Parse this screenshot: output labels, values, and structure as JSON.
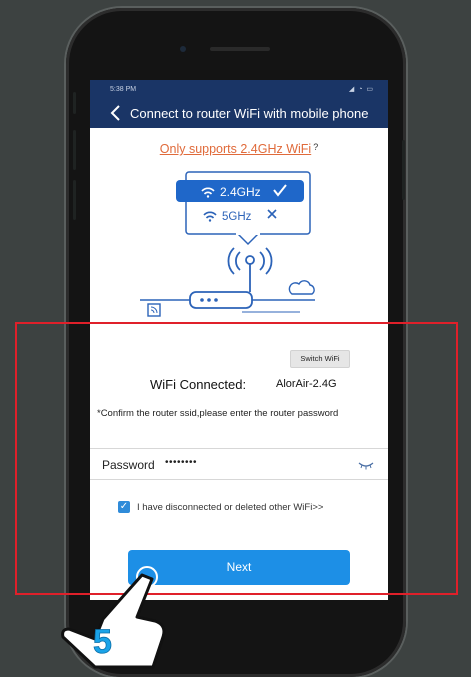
{
  "status_bar": {
    "time": "5:38 PM",
    "icons": "◢ ◔ ▭"
  },
  "nav": {
    "title": "Connect to router WiFi with mobile phone"
  },
  "support": {
    "text": "Only supports 2.4GHz WiFi",
    "help_symbol": "?"
  },
  "illustration": {
    "band_24": "2.4GHz",
    "band_5": "5GHz"
  },
  "switch_wifi_label": "Switch WiFi",
  "wifi": {
    "label": "WiFi Connected:",
    "ssid": "AlorAir-2.4G"
  },
  "confirm_text": "*Confirm the router ssid,please enter the router password",
  "password": {
    "label": "Password",
    "value": "••••••••"
  },
  "disconnect": {
    "checked": true,
    "label": "I have disconnected or deleted other WiFi>>"
  },
  "next_label": "Next",
  "step_number": "5",
  "colors": {
    "nav": "#1a3566",
    "accent": "#1d8fe6",
    "warning": "#e06a3a",
    "highlight": "#e0202a",
    "step": "#1aa3e8"
  }
}
